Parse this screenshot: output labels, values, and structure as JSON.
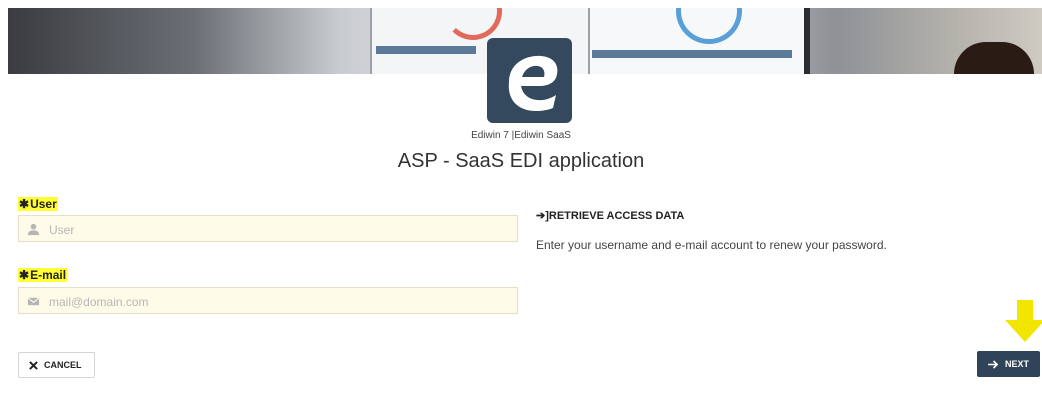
{
  "header": {
    "app_version": "Ediwin 7 |Ediwin SaaS",
    "title": "ASP - SaaS EDI application"
  },
  "form": {
    "user": {
      "required_mark": "✱",
      "label": "User",
      "placeholder": "User",
      "value": ""
    },
    "email": {
      "required_mark": "✱",
      "label": "E-mail",
      "placeholder": "mail@domain.com",
      "value": ""
    }
  },
  "retrieve": {
    "arrow": "➔]",
    "title": "RETRIEVE ACCESS DATA",
    "description": "Enter your username and e-mail account to renew your password."
  },
  "buttons": {
    "cancel": "CANCEL",
    "next": "NEXT"
  },
  "icons": {
    "logo": "ediwin-logo",
    "user": "user-icon",
    "email": "envelope-icon",
    "cancel": "close-icon",
    "next": "arrow-right-icon",
    "hint": "arrow-down-icon"
  },
  "colors": {
    "primary": "#2f4458",
    "logo_bg": "#34495e",
    "highlight": "#ffff33",
    "input_bg": "#fefbe8",
    "hint_arrow": "#f2e600"
  }
}
